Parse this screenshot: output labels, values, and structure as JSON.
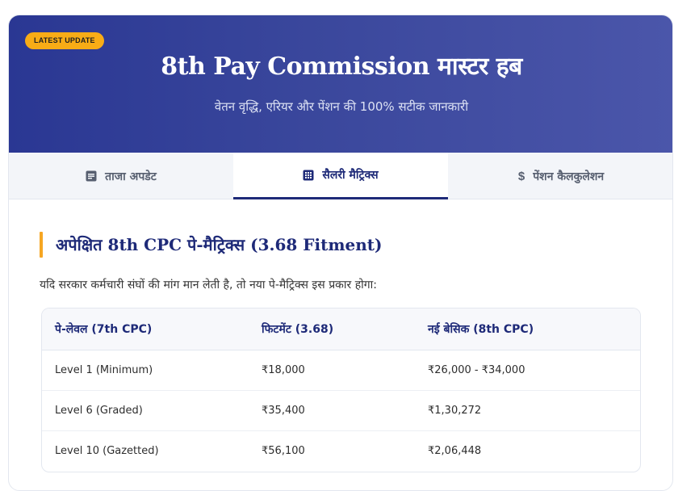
{
  "hero": {
    "badge": "LATEST UPDATE",
    "title": "8th Pay Commission मास्टर हब",
    "subtitle": "वेतन वृद्धि, एरियर और पेंशन की 100% सटीक जानकारी"
  },
  "tabs": [
    {
      "label": "ताजा अपडेट",
      "icon": "document-icon",
      "active": false
    },
    {
      "label": "सैलरी मैट्रिक्स",
      "icon": "calculator-grid-icon",
      "active": true
    },
    {
      "label": "पेंशन कैलकुलेशन",
      "icon": "dollar-icon",
      "active": false
    }
  ],
  "section": {
    "title": "अपेक्षित 8th CPC पे-मैट्रिक्स (3.68 Fitment)",
    "description": "यदि सरकार कर्मचारी संघों की मांग मान लेती है, तो नया पे-मैट्रिक्स इस प्रकार होगा:"
  },
  "table": {
    "headers": [
      "पे-लेवल (7th CPC)",
      "फिटमेंट (3.68)",
      "नई बेसिक (8th CPC)"
    ],
    "rows": [
      [
        "Level 1 (Minimum)",
        "₹18,000",
        "₹26,000 - ₹34,000"
      ],
      [
        "Level 6 (Graded)",
        "₹35,400",
        "₹1,30,272"
      ],
      [
        "Level 10 (Gazetted)",
        "₹56,100",
        "₹2,06,448"
      ]
    ]
  },
  "colors": {
    "hero_start": "#2a3793",
    "hero_end": "#4b56aa",
    "badge": "#f8ac16",
    "accent_navy": "#1e2a78",
    "section_bar": "#f6a623"
  }
}
